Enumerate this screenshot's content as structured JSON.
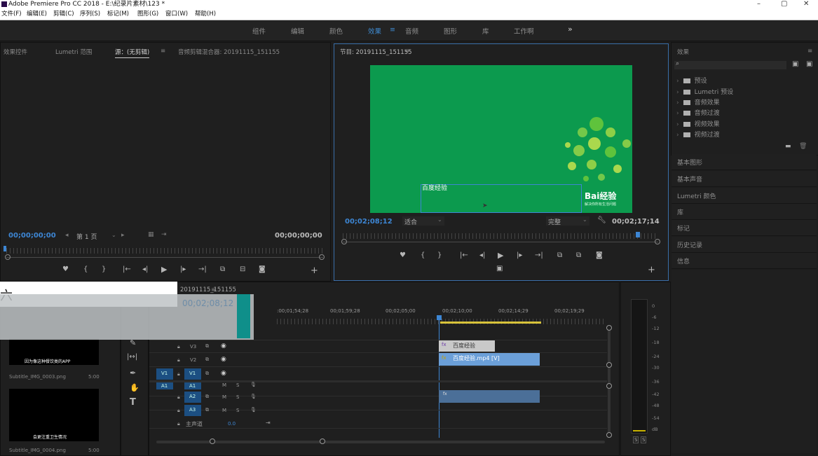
{
  "titlebar": {
    "title": "Adobe Premiere Pro CC 2018 - E:\\纪录片素材\\123 *",
    "minimize": "–",
    "maximize": "▢",
    "close": "✕"
  },
  "menu": [
    "文件(F)",
    "编辑(E)",
    "剪辑(C)",
    "序列(S)",
    "标记(M)",
    "图形(G)",
    "窗口(W)",
    "帮助(H)"
  ],
  "workspaces": {
    "items": [
      "组件",
      "编辑",
      "颜色",
      "效果",
      "音频",
      "图形",
      "库",
      "工作啊"
    ],
    "active": "效果",
    "more": "»"
  },
  "source_panel": {
    "tabs": [
      "效果控件",
      "Lumetri 范围",
      "源：(无剪辑)",
      "音频剪辑混合器: 20191115_151155"
    ],
    "timecode_left": "00;00;00;00",
    "page": "第 1 页",
    "timecode_right": "00;00;00;00"
  },
  "program_panel": {
    "tab": "节目: 20191115_151155",
    "overlay_text": "百度经验",
    "watermark_brand": "Bai经验",
    "watermark_sub": "解决你所有生活问题",
    "timecode_current": "00;02;08;12",
    "fit": "适合",
    "quality": "完整",
    "timecode_total": "00;02;17;14"
  },
  "overlay_popup": {
    "text": "六"
  },
  "timeline": {
    "tab": "20191115_151155",
    "timecode_ghost": "00;02;08;12",
    "ruler_labels": [
      ":00;01;54;28",
      "00;01;59;28",
      "00;02;05;00",
      "00;02;10;00",
      "00;02;14;29",
      "00;02;19;29"
    ],
    "tracks": [
      {
        "id": "V3",
        "sel": ""
      },
      {
        "id": "V2",
        "sel": ""
      },
      {
        "id": "V1",
        "sel": "V1"
      },
      {
        "id": "A1",
        "sel": "A1"
      },
      {
        "id": "A2",
        "sel": ""
      },
      {
        "id": "A3",
        "sel": ""
      }
    ],
    "master_label": "主声道",
    "master_value": "0.0",
    "clips": {
      "v3_title": "百度经验",
      "v2_video": "百度经验.mp4 [V]",
      "a1_fx": "fx"
    }
  },
  "project": {
    "items": [
      {
        "caption": "因为像这种餐饮类的APP",
        "filename": "Subtitle_IMG_0003.png",
        "duration": "5:00"
      },
      {
        "caption": "会更注重卫生情况",
        "filename": "Subtitle_IMG_0004.png",
        "duration": "5:00"
      }
    ]
  },
  "effects_panel": {
    "title": "效果",
    "tree": [
      "预设",
      "Lumetri 预设",
      "音频效果",
      "音频过渡",
      "视频效果",
      "视频过渡"
    ],
    "sections": [
      "基本图形",
      "基本声音",
      "Lumetri 颜色",
      "库",
      "标记",
      "历史记录",
      "信息"
    ]
  },
  "meter": {
    "labels": [
      "0",
      "-6",
      "-12",
      "-18",
      "-24",
      "-30",
      "-36",
      "-42",
      "-48",
      "-54",
      "dB"
    ],
    "solo": [
      "S",
      "S"
    ]
  },
  "colors": {
    "accent": "#3d86d4",
    "program_bg": "#0c9a4e",
    "clip_title": "#c9c9c9",
    "clip_video": "#6b9fd8",
    "clip_audio": "#4b6f98",
    "teal": "#0f8f8a"
  }
}
